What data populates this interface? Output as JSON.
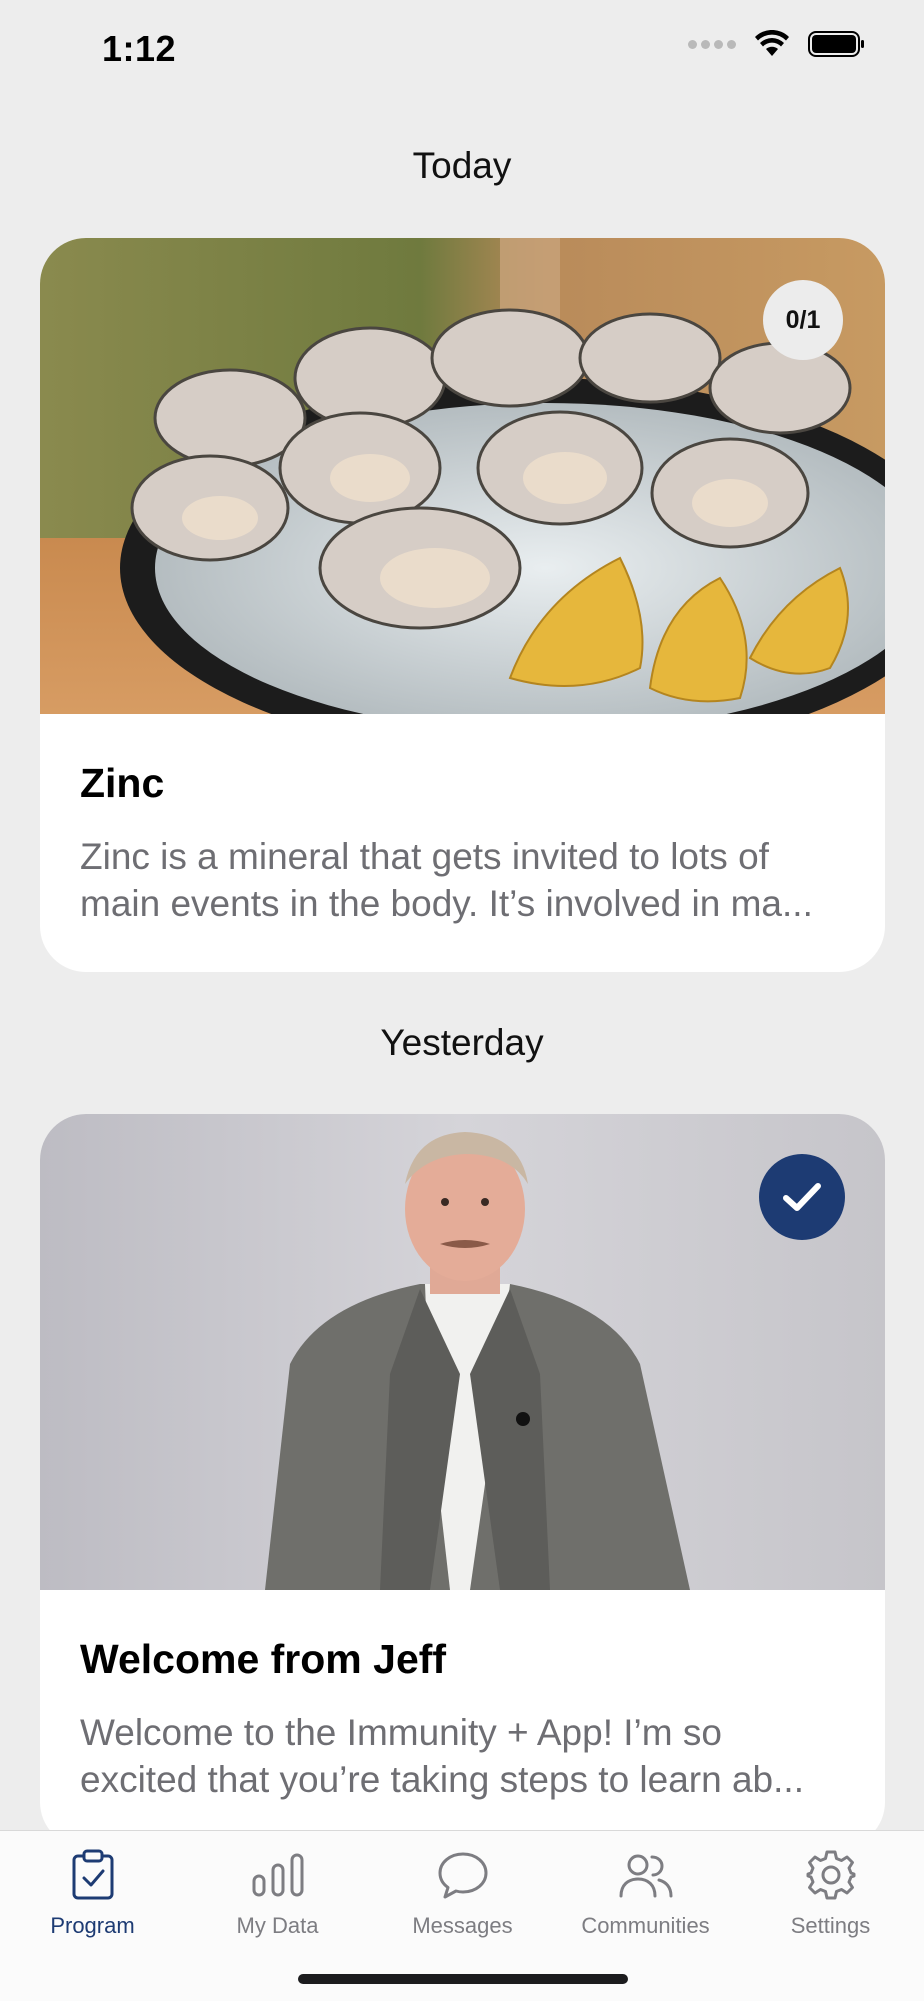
{
  "status_bar": {
    "time": "1:12"
  },
  "sections": {
    "today": "Today",
    "yesterday": "Yesterday"
  },
  "cards": [
    {
      "title": "Zinc",
      "description": "Zinc is a mineral that gets invited to lots of main events in the body. It’s involved in ma...",
      "progress": "0/1",
      "image": "oysters-with-lemon-photo"
    },
    {
      "title": "Welcome from Jeff",
      "description": "Welcome to the Immunity + App! I’m so excited that you’re taking steps to learn ab...",
      "completed": true,
      "image": "man-in-suit-video-still"
    }
  ],
  "tab_bar": {
    "active": "Program",
    "items": [
      {
        "label": "Program",
        "icon": "clipboard-check-icon"
      },
      {
        "label": "My Data",
        "icon": "bar-chart-icon"
      },
      {
        "label": "Messages",
        "icon": "chat-bubble-icon"
      },
      {
        "label": "Communities",
        "icon": "people-icon"
      },
      {
        "label": "Settings",
        "icon": "gear-icon"
      }
    ]
  },
  "colors": {
    "accent": "#1d3b73",
    "background": "#ededed",
    "muted_text": "#6e6e73",
    "tab_inactive": "#7d7d82"
  }
}
